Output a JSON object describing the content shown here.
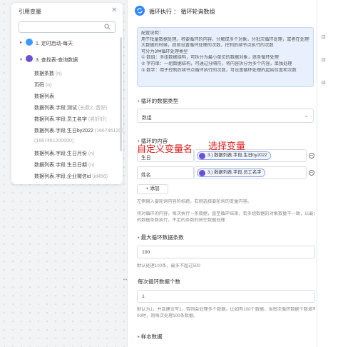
{
  "left_panel": {
    "title": "引用变量",
    "close_icon": "close-icon",
    "search": {
      "placeholder": ""
    },
    "tree": {
      "node1": {
        "label": "1. 定时启动-每天"
      },
      "node3": {
        "label": "3. 查找表-查询数据"
      },
      "children": [
        {
          "label": "数据条数",
          "type": "(n)"
        },
        {
          "label": "页码",
          "type": "(n)"
        },
        {
          "label": "数据列表",
          "type": ""
        },
        {
          "label": "数据列表.字段.测试",
          "type": "(长数2, 音好)"
        },
        {
          "label": "数据列表.字段.员工名字",
          "type": "(名好好)"
        },
        {
          "label": "数据列表.字段.生日by2022",
          "type": "(1667461200000)"
        },
        {
          "label": "数据列表.字段.生日月份",
          "type": "(n)"
        },
        {
          "label": "数据列表.字段.生日日期",
          "type": "(n)"
        },
        {
          "label": "数据列表.字段.企业微信id",
          "type": "(id456)"
        }
      ]
    }
  },
  "header": {
    "title": "循环执行 ： 循环轮询数组"
  },
  "info": {
    "lines": [
      "配置说明：",
      "用于批量数据处理。将要循环的内容，分解成多个对象，分批次循环处理，或者在处理较",
      "大数据的时候，提前设置循环处理的次数，控制后续节点执行的次数",
      "可分为3种循环处理类型",
      "① 数组：多组数据结构，可拆分为最小单位的数据对象，逐条循环处理",
      "② 字符串：一组数据结构，可通过分隔符，将内容拆分为多个内容，单独处理",
      "③ 数字：用于控制后续节点循环执行的次数，可设置循环处理的起始位置和次数"
    ]
  },
  "loop_type": {
    "label": "循环的数据类型",
    "value": "数组"
  },
  "loop_content": {
    "label": "循环的内容",
    "rows": [
      {
        "name": "生日",
        "chip": "3.) 数据列表.字段.生日by2022"
      },
      {
        "name": "姓名",
        "chip": "3.) 数据列表.字段.员工名字"
      }
    ],
    "add_label": "添加"
  },
  "annotations": {
    "custom_var": "自定义变量名",
    "select_var": "选择变量"
  },
  "hints": {
    "name_hint": "左侧输入要轮询内容的标题，右侧选择要轮询的变量内容。",
    "multi_hint_1": "将对循环的内容，每次执行一条数据，直至循环结束，若多组数据的对象数量不一致，以最大",
    "multi_hint_2": "的数据条数执行，不足的条数的按空数据处理"
  },
  "max_loop": {
    "label": "最大循环数据条数",
    "value": "100",
    "hint": "默认处理100条，最多不超过500"
  },
  "per_loop": {
    "label": "每次循环数据个数",
    "value": "1",
    "hint_1": "默认为1，并且建议写1，否则会处理多个数据。比如有100个数据，当每次循环数据个数填写1",
    "hint_2": "00时，则每次处理100条数据。"
  },
  "sample": {
    "label": "样本数据"
  },
  "colors": {
    "accent": "#2f88ff",
    "annotation": "#e02020",
    "chip_icon": "#6c4fd9"
  }
}
